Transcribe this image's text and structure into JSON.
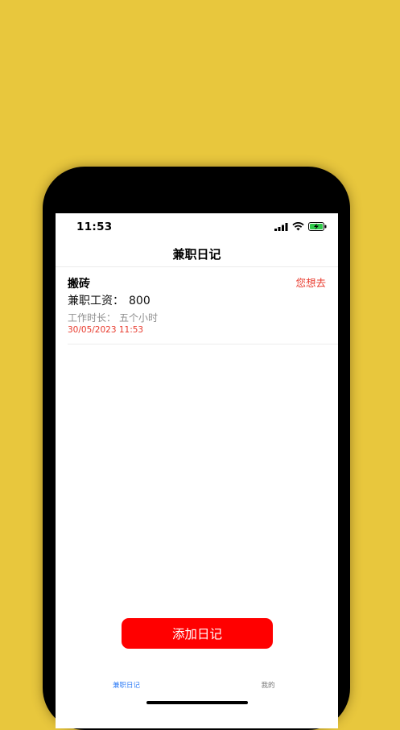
{
  "status_bar": {
    "time": "11:53",
    "icons": [
      "cellular-signal-icon",
      "wifi-icon",
      "battery-charging-icon"
    ]
  },
  "nav": {
    "title": "兼职日记"
  },
  "entries": [
    {
      "title": "搬砖",
      "action": "您想去",
      "wage_label": "兼职工资：",
      "wage_value": "800",
      "hours_label": "工作时长：",
      "hours_value": "五个小时",
      "date": "30/05/2023 11:53"
    }
  ],
  "add_button": {
    "label": "添加日记"
  },
  "tabbar": {
    "items": [
      {
        "label": "兼职日记",
        "active": true
      },
      {
        "label": "我的",
        "active": false
      }
    ]
  },
  "colors": {
    "background": "#e8c73d",
    "accent_red": "#e8392c",
    "button_red": "#ff0000",
    "tab_active": "#2e7cf6"
  }
}
